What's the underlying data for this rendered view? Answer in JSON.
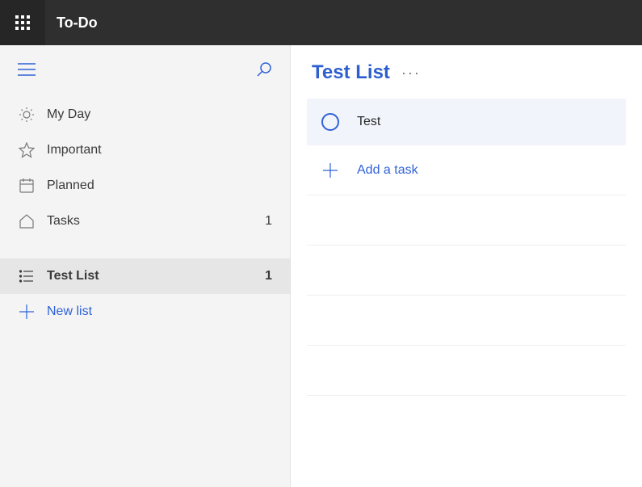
{
  "header": {
    "app_title": "To-Do"
  },
  "sidebar": {
    "items": [
      {
        "label": "My Day",
        "count": ""
      },
      {
        "label": "Important",
        "count": ""
      },
      {
        "label": "Planned",
        "count": ""
      },
      {
        "label": "Tasks",
        "count": "1"
      },
      {
        "label": "Test List",
        "count": "1"
      }
    ],
    "new_list_label": "New list"
  },
  "main": {
    "list_title": "Test List",
    "tasks": [
      {
        "title": "Test"
      }
    ],
    "add_task_label": "Add a task"
  },
  "colors": {
    "accent": "#3062d6",
    "header_bg": "#2f2f2f",
    "sidebar_bg": "#f4f4f4",
    "task_bg": "#f2f4fb"
  }
}
